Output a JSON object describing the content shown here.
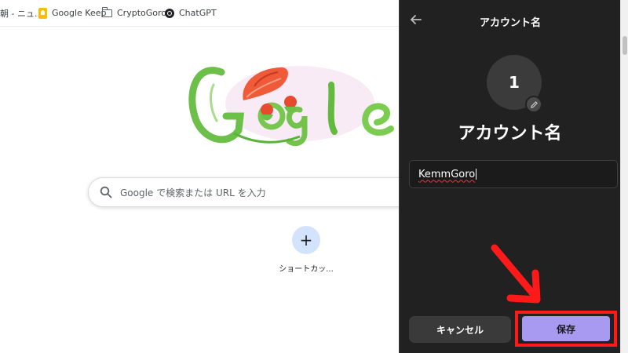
{
  "bookmarks": {
    "news_label": "朝 - ニュ...",
    "keep_label": "Google Keep",
    "crypto_label": "CryptoGoros",
    "chatgpt_label": "ChatGPT"
  },
  "search": {
    "placeholder": "Google で検索または URL を入力"
  },
  "shortcut": {
    "add_symbol": "+",
    "label": "ショートカッ..."
  },
  "dialog": {
    "title": "アカウント名",
    "avatar_text": "1",
    "name_heading": "アカウント名",
    "input_value": "KemmGoro",
    "cancel_label": "キャンセル",
    "save_label": "保存"
  },
  "colors": {
    "dialog_bg": "#212121",
    "save_accent": "#a89af0",
    "highlight_red": "#ff1a1a"
  }
}
